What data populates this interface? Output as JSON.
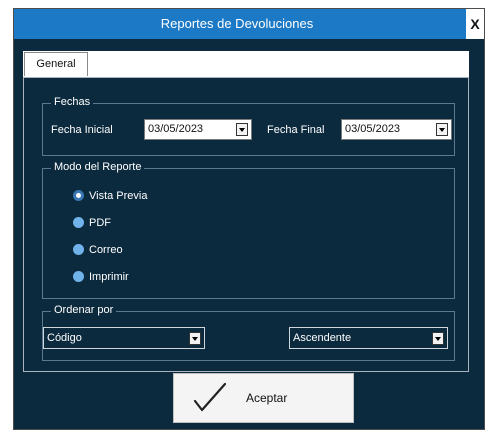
{
  "window": {
    "title": "Reportes de Devoluciones",
    "close_label": "X"
  },
  "tabs": [
    {
      "label": "General"
    }
  ],
  "fechas": {
    "legend": "Fechas",
    "fecha_inicial_label": "Fecha Inicial",
    "fecha_inicial_value": "03/05/2023",
    "fecha_final_label": "Fecha Final",
    "fecha_final_value": "03/05/2023"
  },
  "modo": {
    "legend": "Modo del  Reporte",
    "options": [
      {
        "label": "Vista Previa",
        "checked": true
      },
      {
        "label": "PDF",
        "checked": false
      },
      {
        "label": "Correo",
        "checked": false
      },
      {
        "label": "Imprimir",
        "checked": false
      }
    ]
  },
  "ordenar": {
    "legend": "Ordenar por",
    "field_value": "Código",
    "direction_value": "Ascendente"
  },
  "buttons": {
    "accept_label": "Aceptar"
  },
  "colors": {
    "titlebar": "#1c79c6",
    "background": "#0c2a3e",
    "radio_unselected": "#6fb3ea"
  },
  "icons": {
    "accept": "checkmark-icon",
    "dropdown": "chevron-down-icon"
  }
}
